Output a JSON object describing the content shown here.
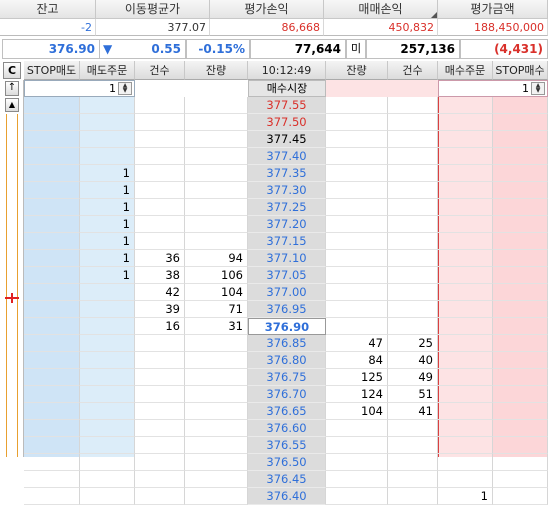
{
  "summary": {
    "headers": [
      "잔고",
      "이동평균가",
      "평가손익",
      "매매손익",
      "평가금액"
    ],
    "values": [
      "-2",
      "377.07",
      "86,668",
      "450,832",
      "188,450,000"
    ]
  },
  "quote": {
    "price": "376.90",
    "change_arrow": "▼",
    "change": "0.55",
    "change_pct": "-0.15%",
    "volume": "77,644",
    "mi_label": "미",
    "open_interest": "257,136",
    "oi_change": "(4,431)"
  },
  "table": {
    "corner_button": "C",
    "headers": [
      "STOP매도",
      "매도주문",
      "건수",
      "잔량",
      "10:12:49",
      "잔량",
      "건수",
      "매수주문",
      "STOP매수"
    ],
    "input_row": {
      "left_qty": "1",
      "center_label": "매수시장",
      "right_qty": "1"
    },
    "rows": [
      {
        "sell_order": "",
        "ask_cnt": "",
        "ask_qty": "",
        "price": "377.55",
        "tone": "red",
        "bid_qty": "",
        "bid_cnt": "",
        "buy_order": ""
      },
      {
        "sell_order": "",
        "ask_cnt": "",
        "ask_qty": "",
        "price": "377.50",
        "tone": "red",
        "bid_qty": "",
        "bid_cnt": "",
        "buy_order": ""
      },
      {
        "sell_order": "",
        "ask_cnt": "",
        "ask_qty": "",
        "price": "377.45",
        "tone": "black",
        "bid_qty": "",
        "bid_cnt": "",
        "buy_order": ""
      },
      {
        "sell_order": "",
        "ask_cnt": "",
        "ask_qty": "",
        "price": "377.40",
        "tone": "blue",
        "bid_qty": "",
        "bid_cnt": "",
        "buy_order": ""
      },
      {
        "sell_order": "1",
        "ask_cnt": "",
        "ask_qty": "",
        "price": "377.35",
        "tone": "blue",
        "bid_qty": "",
        "bid_cnt": "",
        "buy_order": ""
      },
      {
        "sell_order": "1",
        "ask_cnt": "",
        "ask_qty": "",
        "price": "377.30",
        "tone": "blue",
        "bid_qty": "",
        "bid_cnt": "",
        "buy_order": ""
      },
      {
        "sell_order": "1",
        "ask_cnt": "",
        "ask_qty": "",
        "price": "377.25",
        "tone": "blue",
        "bid_qty": "",
        "bid_cnt": "",
        "buy_order": ""
      },
      {
        "sell_order": "1",
        "ask_cnt": "",
        "ask_qty": "",
        "price": "377.20",
        "tone": "blue",
        "bid_qty": "",
        "bid_cnt": "",
        "buy_order": ""
      },
      {
        "sell_order": "1",
        "ask_cnt": "",
        "ask_qty": "",
        "price": "377.15",
        "tone": "blue",
        "bid_qty": "",
        "bid_cnt": "",
        "buy_order": ""
      },
      {
        "sell_order": "1",
        "ask_cnt": "36",
        "ask_qty": "94",
        "price": "377.10",
        "tone": "blue",
        "bid_qty": "",
        "bid_cnt": "",
        "buy_order": ""
      },
      {
        "sell_order": "1",
        "ask_cnt": "38",
        "ask_qty": "106",
        "price": "377.05",
        "tone": "blue",
        "bid_qty": "",
        "bid_cnt": "",
        "buy_order": ""
      },
      {
        "sell_order": "",
        "ask_cnt": "42",
        "ask_qty": "104",
        "price": "377.00",
        "tone": "blue",
        "bid_qty": "",
        "bid_cnt": "",
        "buy_order": ""
      },
      {
        "sell_order": "",
        "ask_cnt": "39",
        "ask_qty": "71",
        "price": "376.95",
        "tone": "blue",
        "bid_qty": "",
        "bid_cnt": "",
        "buy_order": ""
      },
      {
        "sell_order": "",
        "ask_cnt": "16",
        "ask_qty": "31",
        "price": "376.90",
        "tone": "current",
        "bid_qty": "",
        "bid_cnt": "",
        "buy_order": ""
      },
      {
        "sell_order": "",
        "ask_cnt": "",
        "ask_qty": "",
        "price": "376.85",
        "tone": "blue",
        "bid_qty": "47",
        "bid_cnt": "25",
        "buy_order": ""
      },
      {
        "sell_order": "",
        "ask_cnt": "",
        "ask_qty": "",
        "price": "376.80",
        "tone": "blue",
        "bid_qty": "84",
        "bid_cnt": "40",
        "buy_order": ""
      },
      {
        "sell_order": "",
        "ask_cnt": "",
        "ask_qty": "",
        "price": "376.75",
        "tone": "blue",
        "bid_qty": "125",
        "bid_cnt": "49",
        "buy_order": ""
      },
      {
        "sell_order": "",
        "ask_cnt": "",
        "ask_qty": "",
        "price": "376.70",
        "tone": "blue",
        "bid_qty": "124",
        "bid_cnt": "51",
        "buy_order": ""
      },
      {
        "sell_order": "",
        "ask_cnt": "",
        "ask_qty": "",
        "price": "376.65",
        "tone": "blue",
        "bid_qty": "104",
        "bid_cnt": "41",
        "buy_order": ""
      },
      {
        "sell_order": "",
        "ask_cnt": "",
        "ask_qty": "",
        "price": "376.60",
        "tone": "blue",
        "bid_qty": "",
        "bid_cnt": "",
        "buy_order": ""
      },
      {
        "sell_order": "",
        "ask_cnt": "",
        "ask_qty": "",
        "price": "376.55",
        "tone": "blue",
        "bid_qty": "",
        "bid_cnt": "",
        "buy_order": ""
      },
      {
        "sell_order": "",
        "ask_cnt": "",
        "ask_qty": "",
        "price": "376.50",
        "tone": "blue",
        "bid_qty": "",
        "bid_cnt": "",
        "buy_order": ""
      },
      {
        "sell_order": "",
        "ask_cnt": "",
        "ask_qty": "",
        "price": "376.45",
        "tone": "blue",
        "bid_qty": "",
        "bid_cnt": "",
        "buy_order": ""
      },
      {
        "sell_order": "",
        "ask_cnt": "",
        "ask_qty": "",
        "price": "376.40",
        "tone": "blue",
        "bid_qty": "",
        "bid_cnt": "",
        "buy_order": "1"
      }
    ]
  },
  "colors": {
    "sell_bg": "#cfe4f6",
    "sell_order_bg": "#dcedf9",
    "buy_bg": "#fcd6d8",
    "buy_order_bg": "#fde3e4",
    "price_bg": "#dcdcdc",
    "up": "#d9302a",
    "down": "#2f6fd9"
  }
}
